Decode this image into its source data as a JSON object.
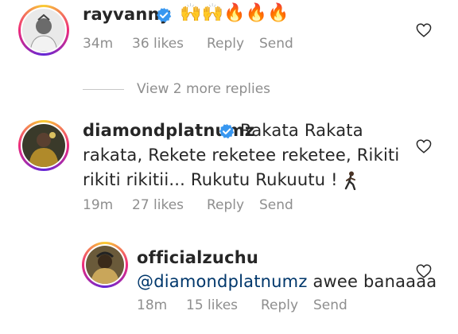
{
  "comments": [
    {
      "username": "rayvanny",
      "text_emoji": "🙌🙌🔥🔥🔥",
      "time": "34m",
      "likes": "36 likes",
      "reply": "Reply",
      "send": "Send"
    },
    {
      "username": "diamondplatnumz",
      "text_line1": "Rakata Rakata",
      "text_line2": "rakata, Rekete reketee reketee, Rikiti",
      "text_line3": "rikiti rikitii... Rukutu Rukuutu !",
      "time": "19m",
      "likes": "27 likes",
      "reply": "Reply",
      "send": "Send"
    },
    {
      "username": "officialzuchu",
      "mention": "@diamondplatnumz",
      "text": "awee banaaaa",
      "time": "18m",
      "likes": "15 likes",
      "reply": "Reply",
      "send": "Send"
    }
  ],
  "view_more_replies": "View 2 more replies",
  "icons": {
    "verified": "verified-badge-icon",
    "like": "heart-outline-icon"
  },
  "colors": {
    "text": "#262626",
    "meta": "#8e8e8e",
    "verified": "#3897f0",
    "mention": "#00376b"
  }
}
